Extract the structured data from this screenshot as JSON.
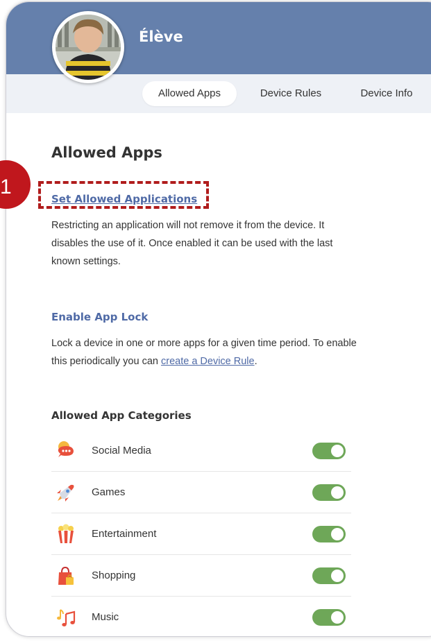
{
  "profile": {
    "name": "Élève"
  },
  "tabs": [
    {
      "label": "Allowed Apps",
      "active": true
    },
    {
      "label": "Device Rules",
      "active": false
    },
    {
      "label": "Device Info",
      "active": false
    }
  ],
  "main": {
    "title": "Allowed Apps",
    "set_allowed": {
      "link_label": "Set Allowed Applications",
      "description": "Restricting an application will not remove it from the device. It disables the use of it. Once enabled it can be used with the last known settings."
    },
    "app_lock": {
      "heading": "Enable App Lock",
      "description_before": "Lock a device in one or more apps for a given time period. To enable this periodically you can ",
      "link_label": "create a Device Rule",
      "description_after": "."
    },
    "categories": {
      "heading": "Allowed App Categories",
      "items": [
        {
          "label": "Social Media",
          "icon": "chat-bubble-icon",
          "enabled": true
        },
        {
          "label": "Games",
          "icon": "rocket-icon",
          "enabled": true
        },
        {
          "label": "Entertainment",
          "icon": "popcorn-icon",
          "enabled": true
        },
        {
          "label": "Shopping",
          "icon": "shopping-bag-icon",
          "enabled": true
        },
        {
          "label": "Music",
          "icon": "music-notes-icon",
          "enabled": true
        }
      ]
    }
  },
  "annotation": {
    "step_number": "1"
  },
  "colors": {
    "header": "#6580ac",
    "tabbar": "#eef1f6",
    "link": "#4f6aa6",
    "toggle_on": "#6ea758",
    "annotation_red": "#c0171d"
  }
}
